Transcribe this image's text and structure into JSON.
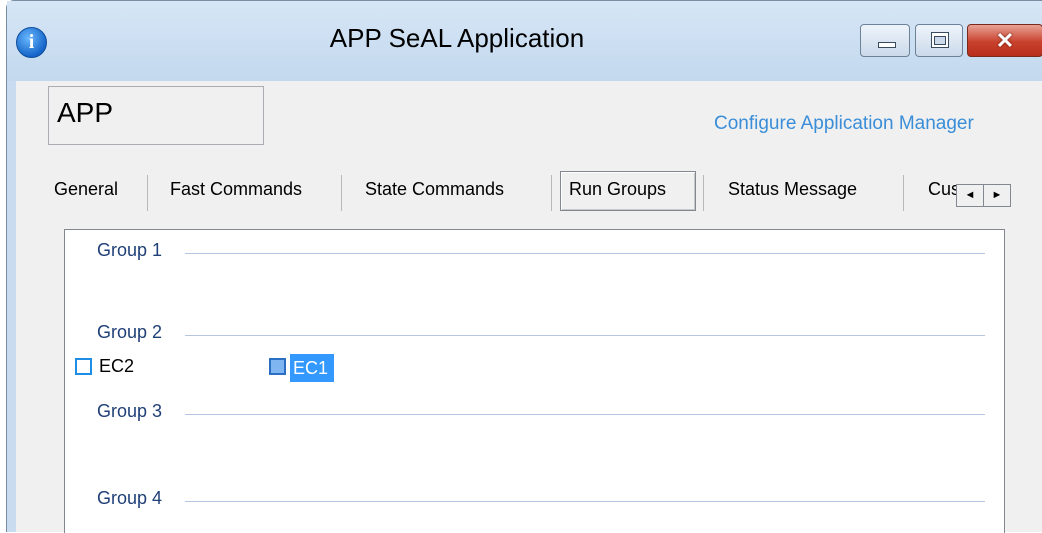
{
  "window": {
    "title": "APP SeAL Application",
    "icon": "info-icon",
    "controls": [
      "minimize",
      "maximize",
      "close"
    ],
    "close_glyph": "✕"
  },
  "app_name_box": {
    "value": "APP"
  },
  "configure_link": "Configure Application Manager",
  "tabs": [
    {
      "label": "General"
    },
    {
      "label": "Fast Commands"
    },
    {
      "label": "State Commands"
    },
    {
      "label": "Run Groups",
      "active": true
    },
    {
      "label": "Status Message"
    },
    {
      "label": "Cus"
    }
  ],
  "tab_scroll": {
    "left": "◄",
    "right": "►"
  },
  "groups": [
    {
      "label": "Group 1",
      "items": []
    },
    {
      "label": "Group 2",
      "items": [
        {
          "label": "EC2",
          "selected": false
        },
        {
          "label": "EC1",
          "selected": true
        }
      ]
    },
    {
      "label": "Group 3",
      "items": []
    },
    {
      "label": "Group 4",
      "items": []
    }
  ],
  "colors": {
    "link": "#3a8ed8",
    "group_label": "#1f3f77",
    "selection": "#3399ff",
    "close_button": "#c8412c"
  }
}
